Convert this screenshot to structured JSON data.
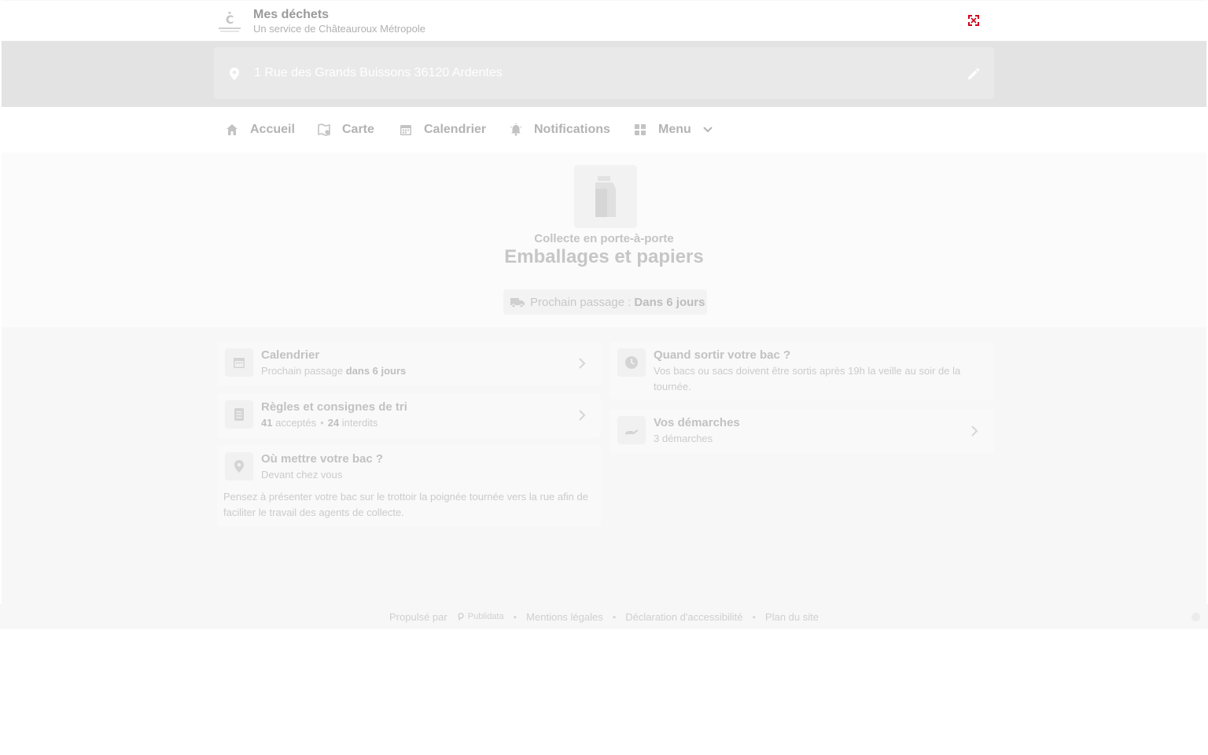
{
  "header": {
    "brand_title": "Mes déchets",
    "brand_subtitle": "Un service de Châteauroux Métropole"
  },
  "address": {
    "text": "1 Rue des Grands Buissons 36120 Ardentes"
  },
  "nav": {
    "items": [
      {
        "label": "Accueil",
        "icon": "home-icon"
      },
      {
        "label": "Carte",
        "icon": "map-icon"
      },
      {
        "label": "Calendrier",
        "icon": "calendar-icon"
      },
      {
        "label": "Notifications",
        "icon": "bell-icon"
      },
      {
        "label": "Menu",
        "icon": "grid-icon"
      }
    ]
  },
  "hero": {
    "kicker": "Collecte en porte-à-porte",
    "title": "Emballages et papiers",
    "next_label": "Prochain passage :",
    "next_value": "Dans 6 jours"
  },
  "cards": {
    "calendar": {
      "title": "Calendrier",
      "sub_prefix": "Prochain passage",
      "sub_bold": "dans 6 jours"
    },
    "rules": {
      "title": "Règles et consignes de tri",
      "accepted_count": "41",
      "accepted_label": "acceptés",
      "forbidden_count": "24",
      "forbidden_label": "interdits"
    },
    "where": {
      "title": "Où mettre votre bac ?",
      "sub": "Devant chez vous",
      "body": "Pensez à présenter votre bac sur le trottoir la poignée tournée vers la rue afin de faciliter le travail des agents de collecte."
    },
    "when": {
      "title": "Quand sortir votre bac ?",
      "body": "Vos bacs ou sacs doivent être sortis après 19h la veille au soir de la tournée."
    },
    "procedures": {
      "title": "Vos démarches",
      "sub": "3 démarches"
    }
  },
  "footer": {
    "powered_by": "Propulsé par",
    "publidata": "Publidata",
    "links": [
      "Mentions légales",
      "Déclaration d'accessibilité",
      "Plan du site"
    ]
  },
  "colors": {
    "flag_red": "#d0021b"
  }
}
